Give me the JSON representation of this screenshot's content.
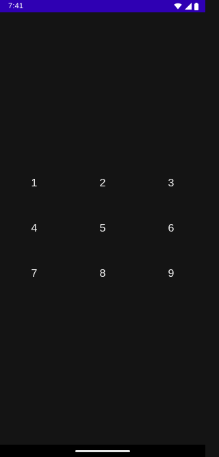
{
  "status_bar": {
    "time": "7:41",
    "background_color": "#2f00b3",
    "icons": [
      "wifi-icon",
      "cell-signal-icon",
      "battery-icon"
    ]
  },
  "keypad": {
    "keys": [
      {
        "label": "1"
      },
      {
        "label": "2"
      },
      {
        "label": "3"
      },
      {
        "label": "4"
      },
      {
        "label": "5"
      },
      {
        "label": "6"
      },
      {
        "label": "7"
      },
      {
        "label": "8"
      },
      {
        "label": "9"
      }
    ]
  },
  "colors": {
    "background": "#141414",
    "text": "#f2f2f2",
    "nav_bar": "#000000"
  }
}
